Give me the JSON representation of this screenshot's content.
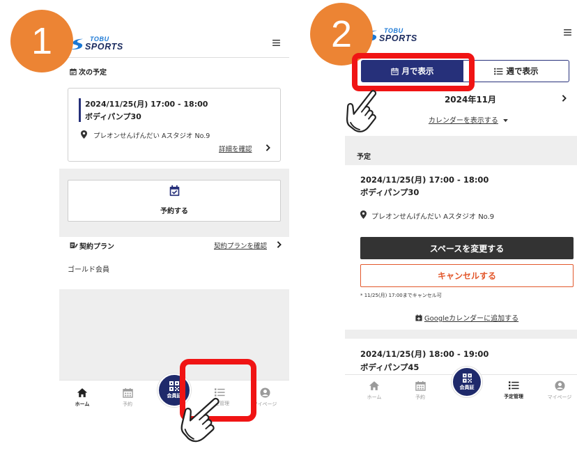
{
  "colors": {
    "step_badge": "#ec8434",
    "highlight_box": "#f01414",
    "navy": "#26307a",
    "member_button": "#1f2a6b",
    "cancel": "#e2572b",
    "dark_button": "#333333",
    "gray_band": "#eeeeee",
    "logo_blue": "#1a77d4"
  },
  "steps": {
    "first": "1",
    "second": "2"
  },
  "screen1": {
    "logo": {
      "line1": "TOBU",
      "line2": "SPORTS"
    },
    "next_schedule": {
      "heading": "次の予定",
      "datetime": "2024/11/25(月) 17:00 - 18:00",
      "program": "ボディパンプ30",
      "location": "プレオンせんげんだい Aスタジオ No.9",
      "details_link": "詳細を確認"
    },
    "reserve_button": "予約する",
    "plan": {
      "heading": "契約プラン",
      "link": "契約プランを確認",
      "value": "ゴールド会員"
    },
    "nav": [
      {
        "label": "ホーム",
        "icon": "home-icon",
        "active": true
      },
      {
        "label": "予約",
        "icon": "calendar-icon",
        "active": false
      },
      {
        "label": "会員証",
        "icon": "qr-code-icon",
        "active": false
      },
      {
        "label": "予定管理",
        "icon": "list-icon",
        "active": false
      },
      {
        "label": "マイページ",
        "icon": "user-icon",
        "active": false
      }
    ]
  },
  "screen2": {
    "logo": {
      "line1": "TOBU",
      "line2": "SPORTS"
    },
    "view_tabs": [
      {
        "label": "月で表示",
        "icon": "calendar-icon",
        "selected": true
      },
      {
        "label": "週で表示",
        "icon": "list-icon",
        "selected": false
      }
    ],
    "month": "2024年11月",
    "show_calendar_link": "カレンダーを表示する",
    "section_heading": "予定",
    "reservations": [
      {
        "datetime": "2024/11/25(月) 17:00 - 18:00",
        "program": "ボディパンプ30",
        "location": "プレオンせんげんだい Aスタジオ No.9",
        "change_space_button": "スペースを変更する",
        "cancel_button": "キャンセルする",
        "cancel_note": "* 11/25(月) 17:00までキャンセル可",
        "google_calendar_link": "Googleカレンダーに追加する"
      },
      {
        "datetime": "2024/11/25(月) 18:00 - 19:00",
        "program": "ボディパンプ45"
      }
    ],
    "nav": [
      {
        "label": "ホーム",
        "icon": "home-icon",
        "active": false
      },
      {
        "label": "予約",
        "icon": "calendar-icon",
        "active": false
      },
      {
        "label": "会員証",
        "icon": "qr-code-icon",
        "active": false
      },
      {
        "label": "予定管理",
        "icon": "list-icon",
        "active": true
      },
      {
        "label": "マイページ",
        "icon": "user-icon",
        "active": false
      }
    ]
  }
}
